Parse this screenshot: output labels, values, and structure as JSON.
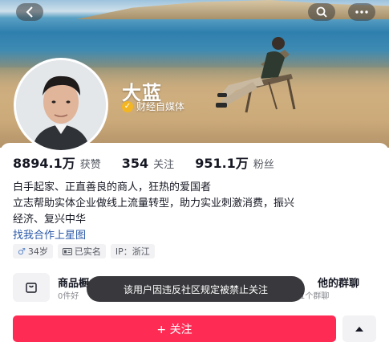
{
  "profile": {
    "nickname": "大蓝",
    "verification": "财经自媒体"
  },
  "stats": [
    {
      "value": "8894.1万",
      "label": "获赞"
    },
    {
      "value": "354",
      "label": "关注"
    },
    {
      "value": "951.1万",
      "label": "粉丝"
    }
  ],
  "bio": {
    "line1": "白手起家、正直善良的商人，狂热的爱国者",
    "line2": "立志帮助实体企业做线上流量转型，助力实业刺激消费，振兴",
    "line3": "经济、复兴中华",
    "link": "找我合作上星图"
  },
  "tags": {
    "age": "34岁",
    "age_icon": "male-icon",
    "verified": "已实名",
    "ip": "IP：浙江"
  },
  "shop": {
    "title": "商品橱",
    "sub": "0件好"
  },
  "group": {
    "title": "他的群聊",
    "sub": "1个群聊"
  },
  "toast": "该用户因违反社区规定被禁止关注",
  "actions": {
    "follow": "+ 关注"
  },
  "colors": {
    "accent": "#fe2c55",
    "verify_badge": "#f3b622",
    "link": "#2a58a7"
  }
}
